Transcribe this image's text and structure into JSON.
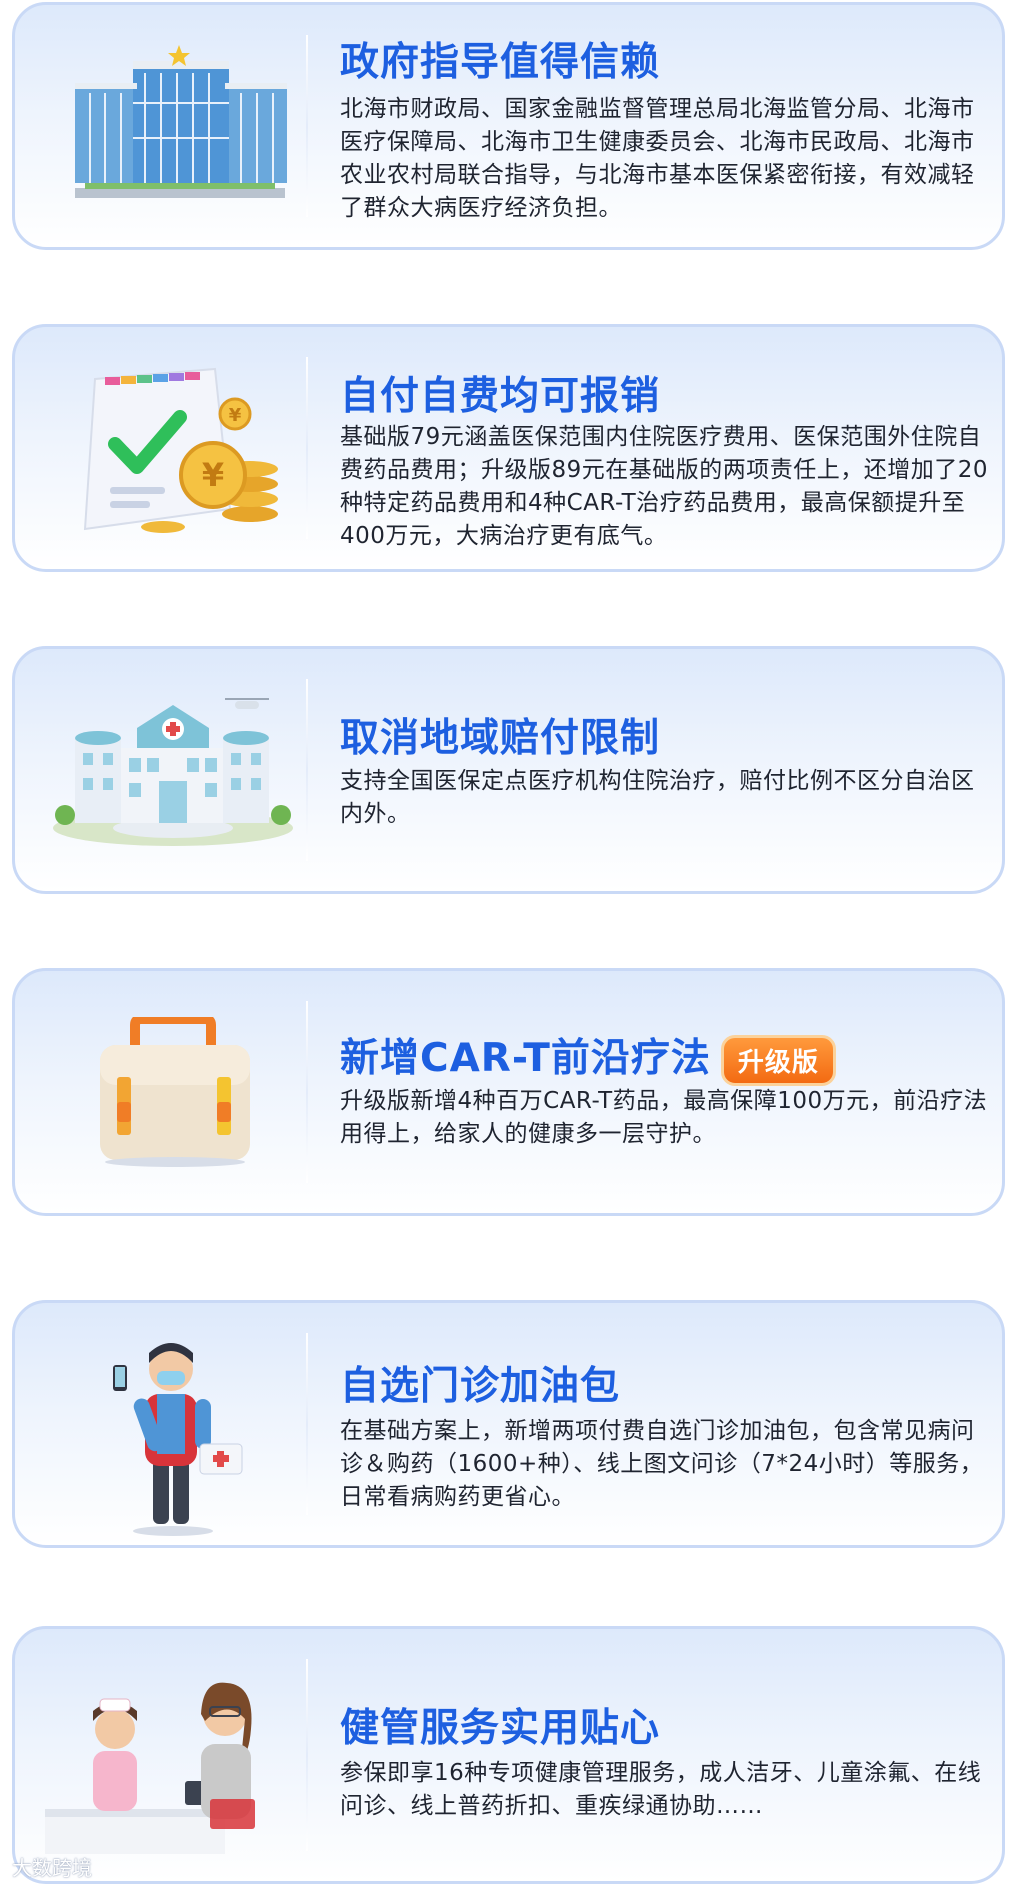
{
  "cards": [
    {
      "title": "政府指导值得信赖",
      "desc": "北海市财政局、国家金融监督管理总局北海监管分局、北海市医疗保障局、北海市卫生健康委员会、北海市民政局、北海市农业农村局联合指导，与北海市基本医保紧密衔接，有效减轻了群众大病医疗经济负担。",
      "icon": "government-building-icon"
    },
    {
      "title": "自付自费均可报销",
      "desc": "基础版79元涵盖医保范围内住院医疗费用、医保范围外住院自费药品费用；升级版89元在基础版的两项责任上，还增加了20种特定药品费用和4种CAR-T治疗药品费用，最高保额提升至400万元，大病治疗更有底气。",
      "icon": "receipt-coins-icon"
    },
    {
      "title": "取消地域赔付限制",
      "desc": "支持全国医保定点医疗机构住院治疗，赔付比例不区分自治区内外。",
      "icon": "hospital-icon"
    },
    {
      "title": "新增CAR-T前沿疗法",
      "badge": "升级版",
      "desc": "升级版新增4种百万CAR-T药品，最高保障100万元，前沿疗法用得上，给家人的健康多一层守护。",
      "icon": "medical-kit-icon"
    },
    {
      "title": "自选门诊加油包",
      "desc": "在基础方案上，新增两项付费自选门诊加油包，包含常见病问诊＆购药（1600+种）、线上图文问诊（7*24小时）等服务，日常看病购药更省心。",
      "icon": "delivery-person-icon"
    },
    {
      "title": "健管服务实用贴心",
      "desc": "参保即享16种专项健康管理服务，成人洁牙、儿童涂氟、在线问诊、线上普药折扣、重疾绿通协助……",
      "icon": "nurse-pharmacy-icon"
    }
  ],
  "watermark": "大数跨境",
  "colors": {
    "title": "#1d5fe0",
    "border": "#c9d9f6",
    "badge": "#f36a12"
  }
}
